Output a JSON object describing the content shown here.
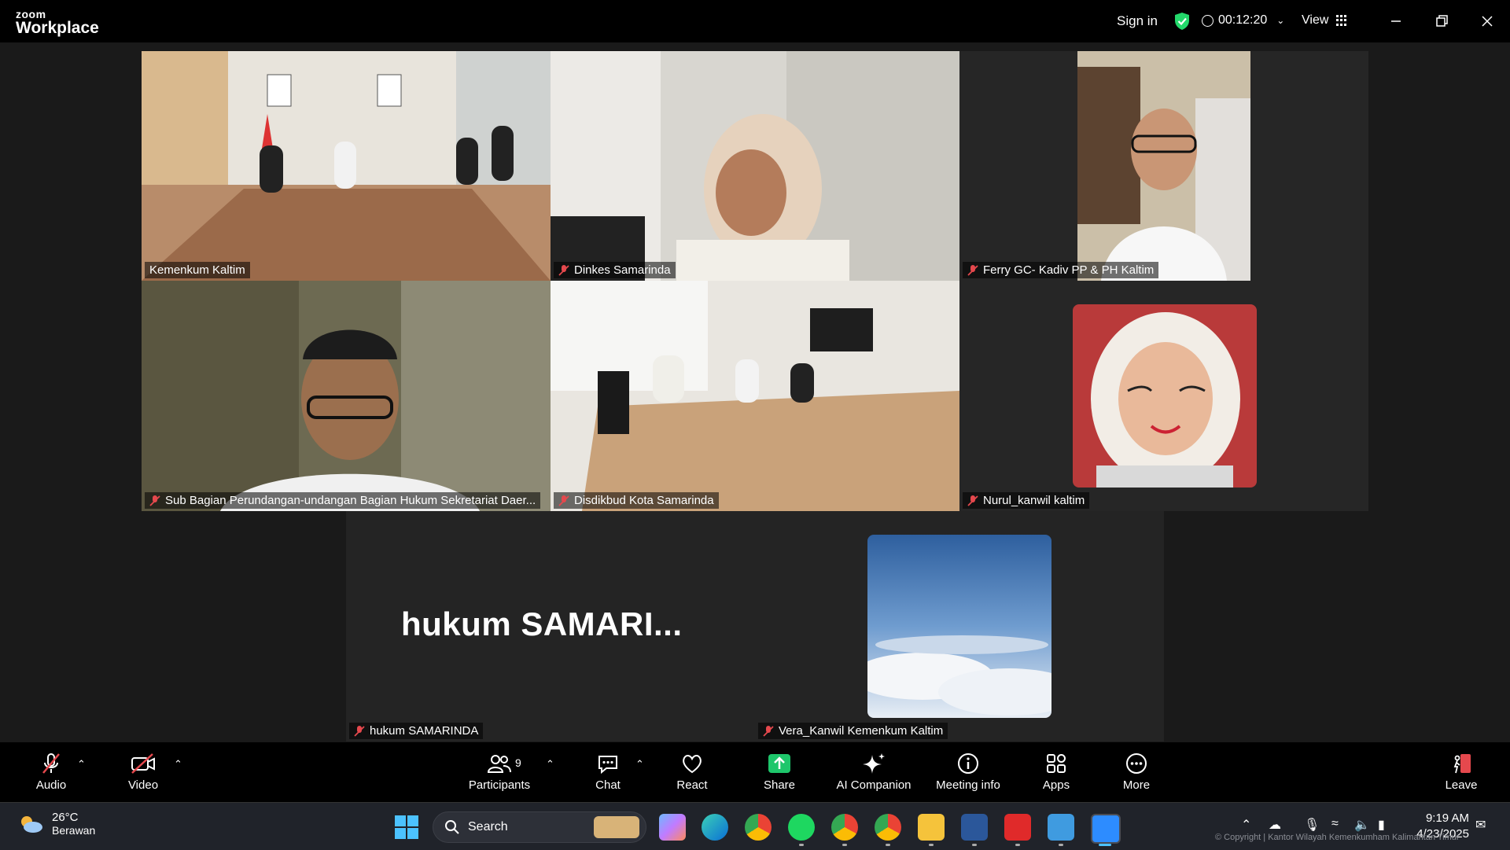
{
  "app": {
    "logo_small": "zoom",
    "logo_big": "Workplace"
  },
  "header": {
    "sign_in": "Sign in",
    "timer": "00:12:20",
    "view": "View"
  },
  "participants": [
    {
      "name": "Kemenkum Kaltim",
      "muted": false,
      "active_speaker": true
    },
    {
      "name": "Dinkes Samarinda",
      "muted": true
    },
    {
      "name": "Ferry GC- Kadiv PP & PH Kaltim",
      "muted": true
    },
    {
      "name": "Sub Bagian Perundangan-undangan Bagian Hukum Sekretariat Daer...",
      "muted": true
    },
    {
      "name": "Disdikbud Kota Samarinda",
      "muted": true
    },
    {
      "name": "Nurul_kanwil kaltim",
      "muted": true
    },
    {
      "name": "hukum SAMARINDA",
      "muted": true,
      "display_text": "hukum  SAMARI..."
    },
    {
      "name": "Vera_Kanwil Kemenkum Kaltim",
      "muted": true
    }
  ],
  "toolbar": {
    "audio": "Audio",
    "video": "Video",
    "participants": "Participants",
    "participants_count": "9",
    "chat": "Chat",
    "react": "React",
    "share": "Share",
    "ai_companion": "AI Companion",
    "meeting_info": "Meeting info",
    "apps": "Apps",
    "more": "More",
    "leave": "Leave"
  },
  "taskbar": {
    "weather_temp": "26°C",
    "weather_desc": "Berawan",
    "search_placeholder": "Search",
    "time": "9:19 AM",
    "date": "4/23/2025",
    "watermark": "© Copyright | Kantor Wilayah Kemenkumham Kalimantan Timur"
  },
  "colors": {
    "active_speaker": "#23d96b",
    "share_green": "#1ec66b",
    "leave_red": "#e5484d",
    "muted_red": "#e5484d"
  }
}
